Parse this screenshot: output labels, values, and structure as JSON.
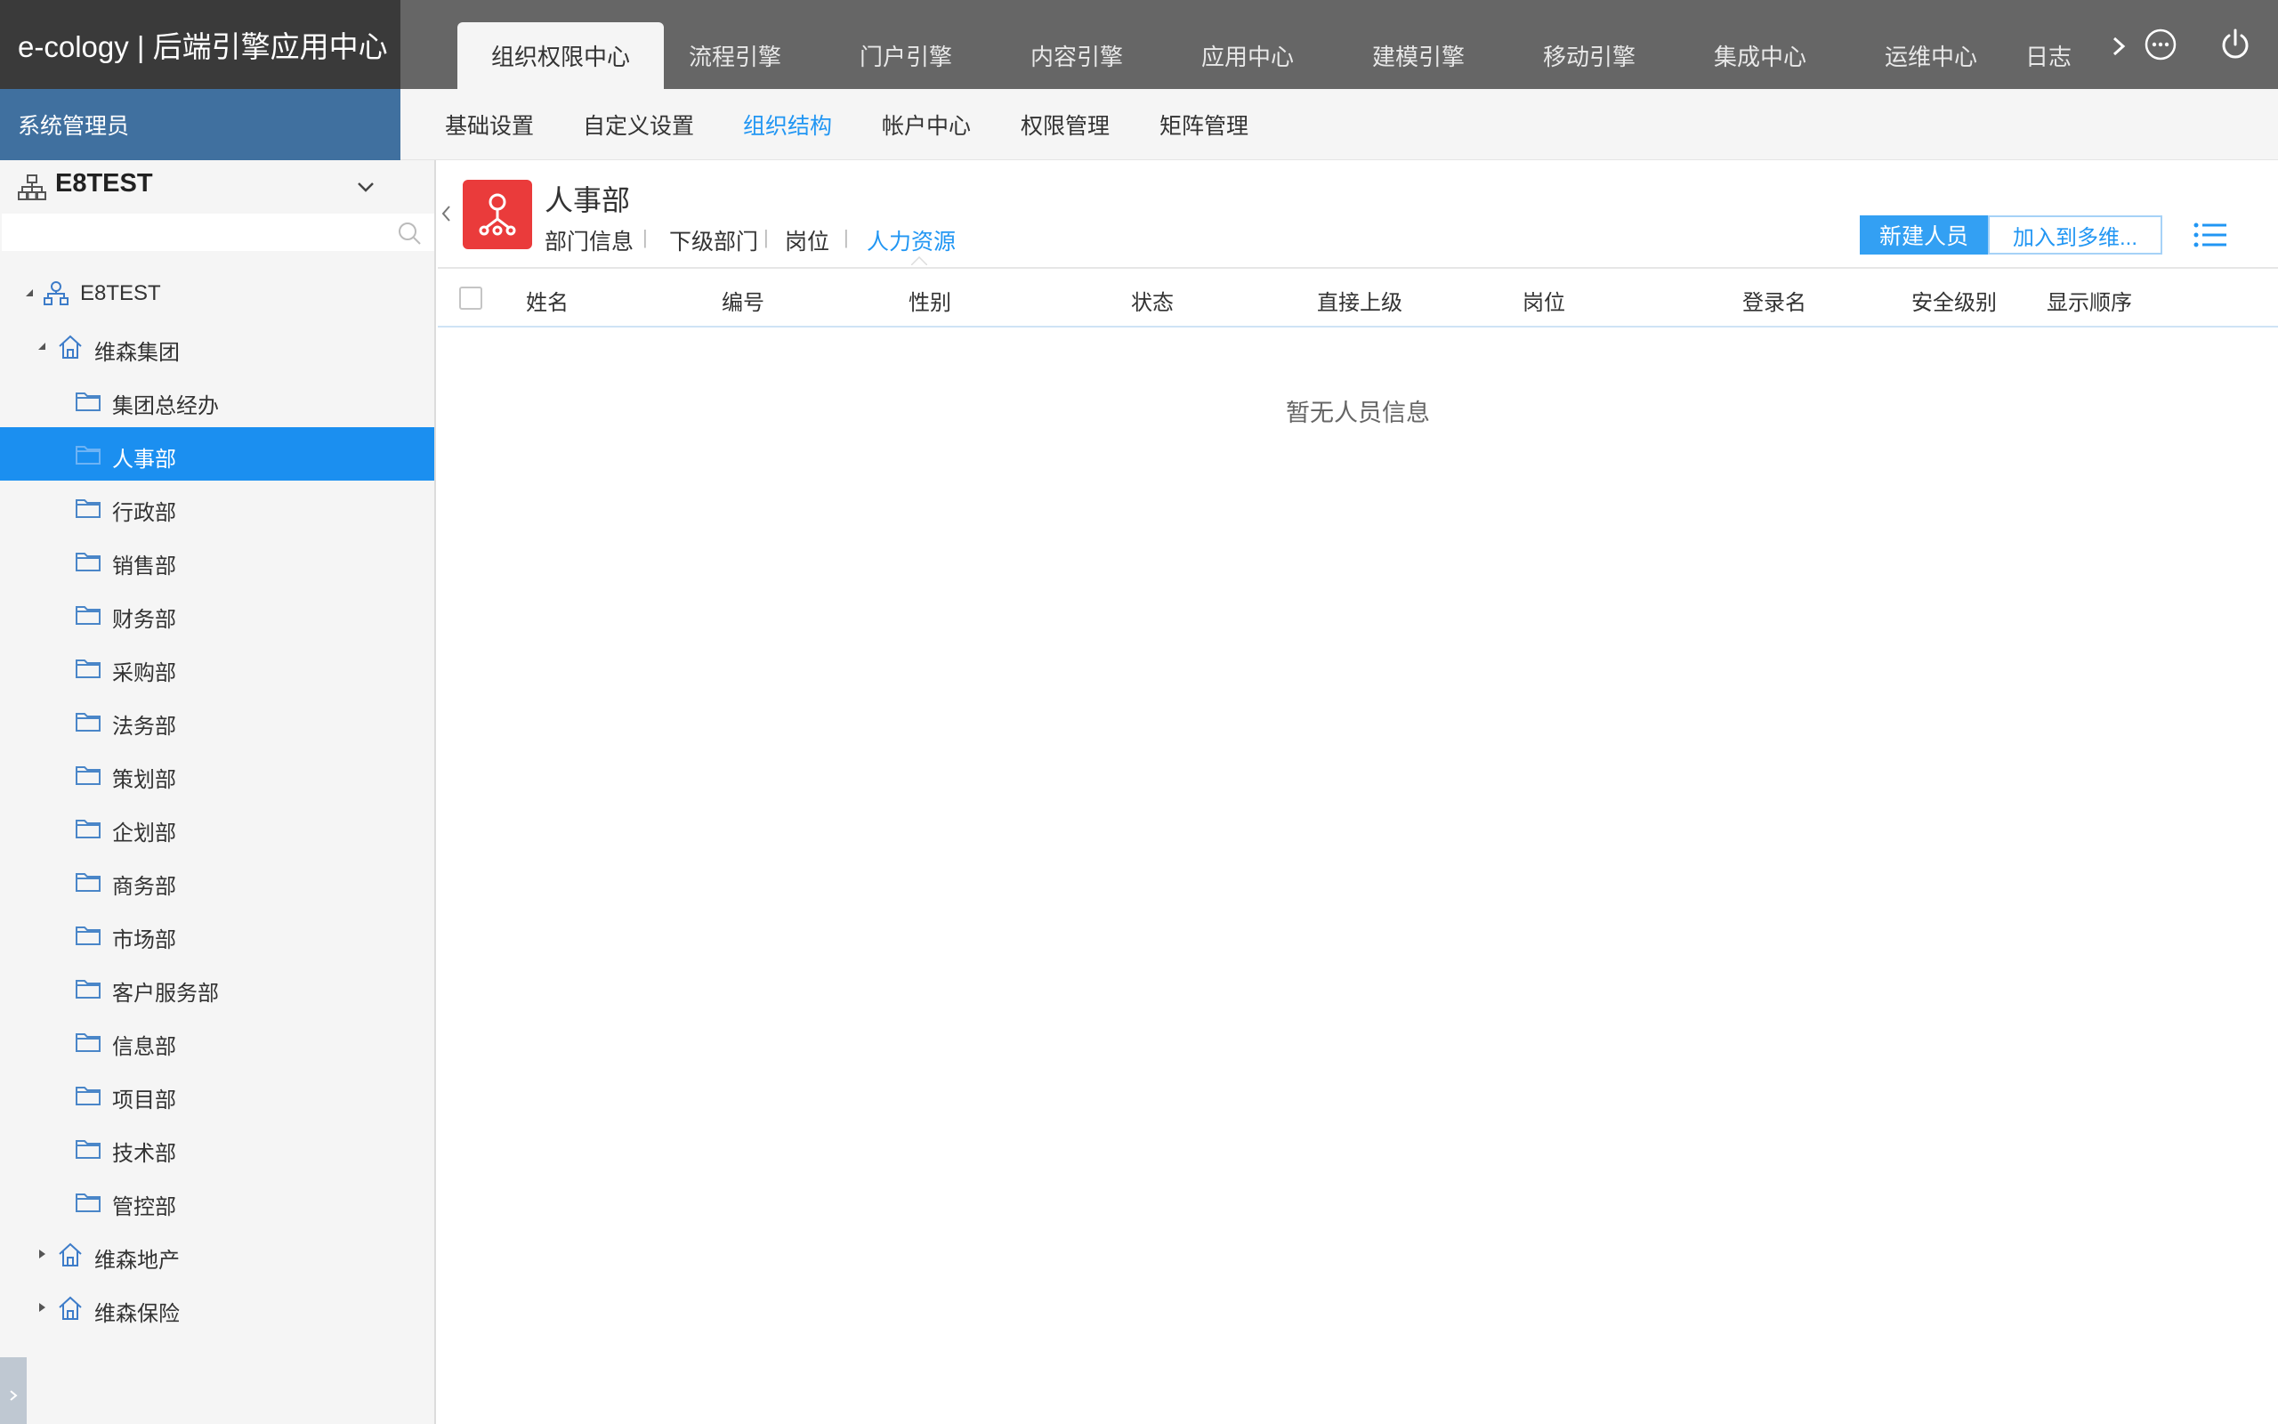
{
  "app": {
    "brand": "e-cology | 后端引擎应用中心",
    "user": "系统管理员"
  },
  "main_tabs": [
    {
      "label": "组织权限中心",
      "active": true
    },
    {
      "label": "流程引擎",
      "active": false
    },
    {
      "label": "门户引擎",
      "active": false
    },
    {
      "label": "内容引擎",
      "active": false
    },
    {
      "label": "应用中心",
      "active": false
    },
    {
      "label": "建模引擎",
      "active": false
    },
    {
      "label": "移动引擎",
      "active": false
    },
    {
      "label": "集成中心",
      "active": false
    },
    {
      "label": "运维中心",
      "active": false
    },
    {
      "label": "日志",
      "active": false
    }
  ],
  "top_icons": {
    "more": "more-circle-icon",
    "power": "power-icon"
  },
  "sub_nav": [
    {
      "label": "基础设置",
      "active": false
    },
    {
      "label": "自定义设置",
      "active": false
    },
    {
      "label": "组织结构",
      "active": true
    },
    {
      "label": "帐户中心",
      "active": false
    },
    {
      "label": "权限管理",
      "active": false
    },
    {
      "label": "矩阵管理",
      "active": false
    }
  ],
  "sidebar": {
    "org_name": "E8TEST",
    "search_placeholder": "",
    "tree": [
      {
        "label": "E8TEST",
        "type": "org",
        "expanded": true
      },
      {
        "label": "维森集团",
        "type": "company",
        "expanded": true
      },
      {
        "label": "集团总经办",
        "type": "dept"
      },
      {
        "label": "人事部",
        "type": "dept",
        "selected": true
      },
      {
        "label": "行政部",
        "type": "dept"
      },
      {
        "label": "销售部",
        "type": "dept"
      },
      {
        "label": "财务部",
        "type": "dept"
      },
      {
        "label": "采购部",
        "type": "dept"
      },
      {
        "label": "法务部",
        "type": "dept"
      },
      {
        "label": "策划部",
        "type": "dept"
      },
      {
        "label": "企划部",
        "type": "dept"
      },
      {
        "label": "商务部",
        "type": "dept"
      },
      {
        "label": "市场部",
        "type": "dept"
      },
      {
        "label": "客户服务部",
        "type": "dept"
      },
      {
        "label": "信息部",
        "type": "dept"
      },
      {
        "label": "项目部",
        "type": "dept"
      },
      {
        "label": "技术部",
        "type": "dept"
      },
      {
        "label": "管控部",
        "type": "dept"
      },
      {
        "label": "维森地产",
        "type": "company",
        "expanded": false
      },
      {
        "label": "维森保险",
        "type": "company",
        "expanded": false
      }
    ]
  },
  "content": {
    "dept_title": "人事部",
    "dept_tabs": [
      "部门信息",
      "下级部门",
      "岗位",
      "人力资源"
    ],
    "active_dept_tab": "人力资源",
    "buttons": {
      "new_person": "新建人员",
      "add_to_multi": "加入到多维..."
    },
    "columns": [
      "姓名",
      "编号",
      "性别",
      "状态",
      "直接上级",
      "岗位",
      "登录名",
      "安全级别",
      "显示顺序"
    ],
    "empty_message": "暂无人员信息"
  },
  "colors": {
    "topbar": "#666666",
    "brand_bg": "#3a3a3a",
    "userbar": "#40709f",
    "selected_node": "#1b8ff0",
    "accent": "#2196f3",
    "dept_icon": "#ea3b3b"
  }
}
